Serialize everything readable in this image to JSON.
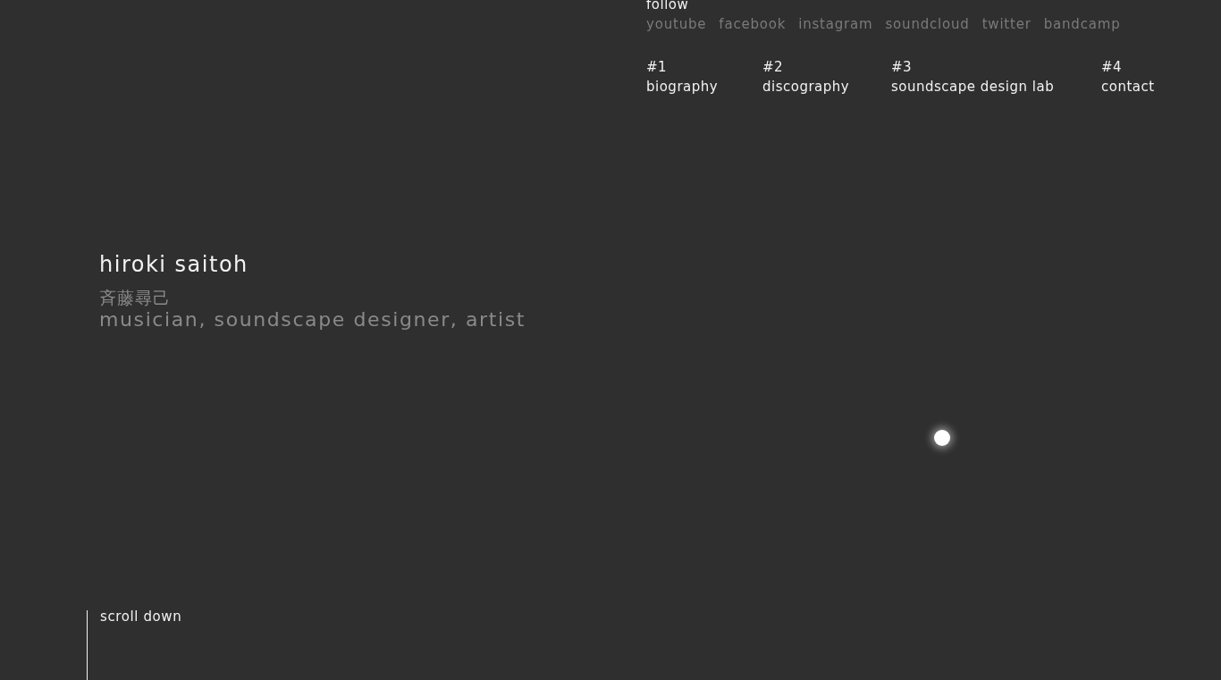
{
  "follow": {
    "label": "follow",
    "links": [
      "youtube",
      "facebook",
      "instagram",
      "soundcloud",
      "twitter",
      "bandcamp"
    ]
  },
  "nav": [
    {
      "number": "#1",
      "label": "biography"
    },
    {
      "number": "#2",
      "label": "discography"
    },
    {
      "number": "#3",
      "label": "soundscape design lab"
    },
    {
      "number": "#4",
      "label": "contact"
    }
  ],
  "hero": {
    "name": "hiroki saitoh",
    "name_japanese": "斉藤尋己",
    "roles": "musician, soundscape designer, artist"
  },
  "scroll_hint": "scroll down"
}
